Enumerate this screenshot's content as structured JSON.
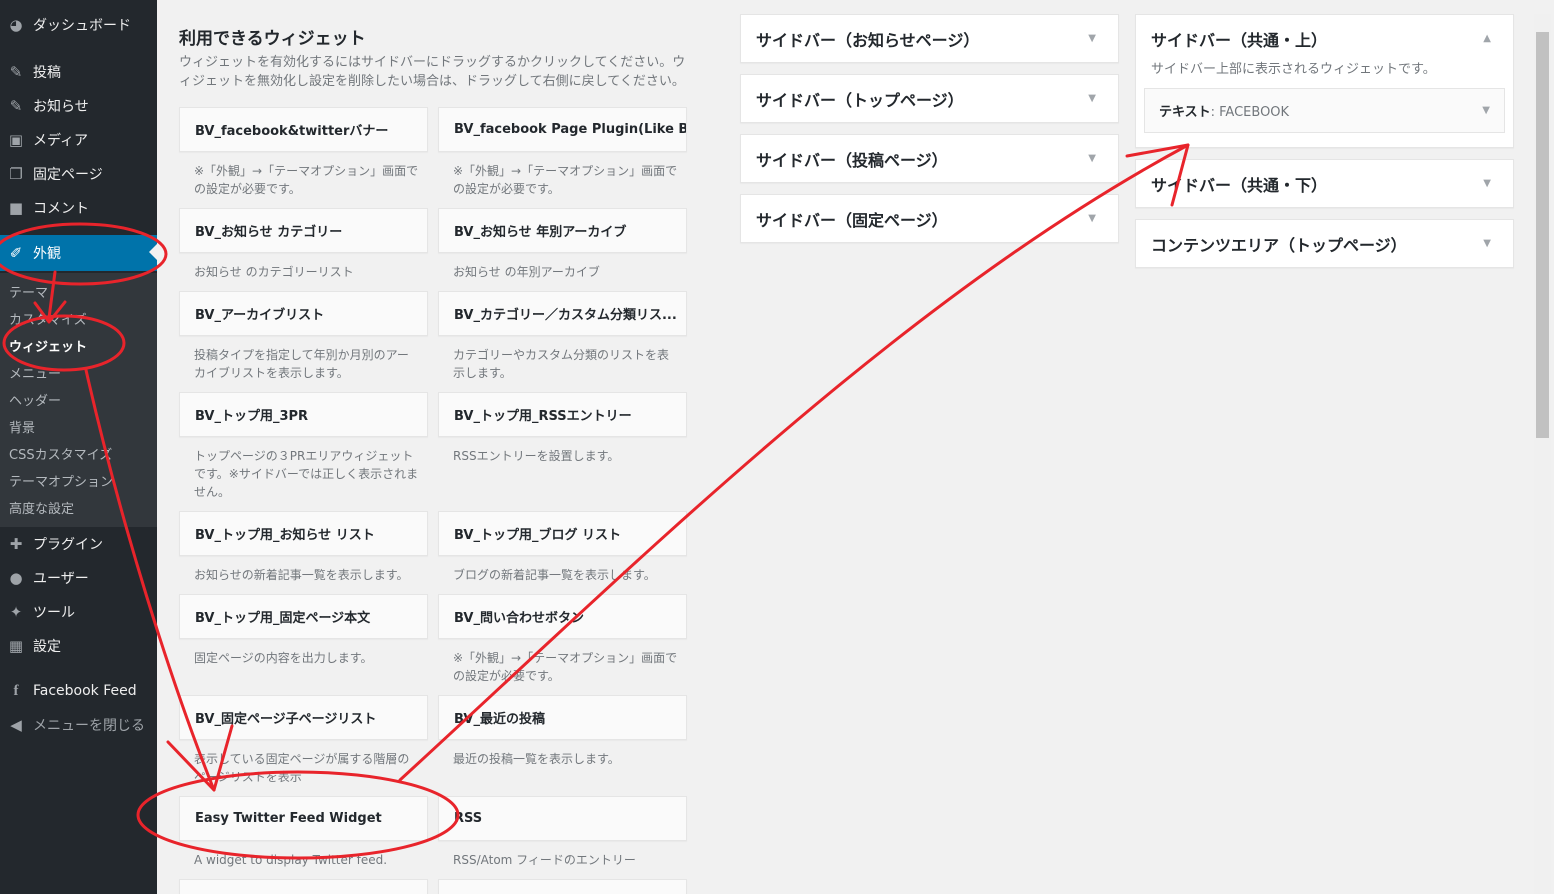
{
  "sidebar": {
    "items": [
      {
        "label": "ダッシュボード",
        "icon": "dashboard-icon"
      },
      {
        "label": "投稿",
        "icon": "pin-icon"
      },
      {
        "label": "お知らせ",
        "icon": "pin-icon"
      },
      {
        "label": "メディア",
        "icon": "media-icon"
      },
      {
        "label": "固定ページ",
        "icon": "page-icon"
      },
      {
        "label": "コメント",
        "icon": "comment-icon"
      },
      {
        "label": "外観",
        "icon": "brush-icon"
      },
      {
        "label": "プラグイン",
        "icon": "plugin-icon"
      },
      {
        "label": "ユーザー",
        "icon": "user-icon"
      },
      {
        "label": "ツール",
        "icon": "wrench-icon"
      },
      {
        "label": "設定",
        "icon": "settings-icon"
      },
      {
        "label": "Facebook Feed",
        "icon": "facebook-icon"
      },
      {
        "label": "メニューを閉じる",
        "icon": "collapse-icon"
      }
    ],
    "submenu": [
      "テーマ",
      "カスタマイズ",
      "ウィジェット",
      "メニュー",
      "ヘッダー",
      "背景",
      "CSSカスタマイズ",
      "テーマオプション",
      "高度な設定"
    ]
  },
  "available": {
    "title": "利用できるウィジェット",
    "description": "ウィジェットを有効化するにはサイドバーにドラッグするかクリックしてください。ウィジェットを無効化し設定を削除したい場合は、ドラッグして右側に戻してください。",
    "widgets": [
      {
        "name": "BV_facebook&twitterバナー",
        "desc": "※「外観」→「テーマオプション」画面での設定が必要です。"
      },
      {
        "name": "BV_facebook Page Plugin(Like B...",
        "desc": "※「外観」→「テーマオプション」画面での設定が必要です。"
      },
      {
        "name": "BV_お知らせ カテゴリー",
        "desc": "お知らせ のカテゴリーリスト"
      },
      {
        "name": "BV_お知らせ 年別アーカイブ",
        "desc": "お知らせ の年別アーカイブ"
      },
      {
        "name": "BV_アーカイブリスト",
        "desc": "投稿タイプを指定して年別か月別のアーカイブリストを表示します。"
      },
      {
        "name": "BV_カテゴリー／カスタム分類リス...",
        "desc": "カテゴリーやカスタム分類のリストを表示します。"
      },
      {
        "name": "BV_トップ用_3PR",
        "desc": "トップページの３PRエリアウィジェットです。※サイドバーでは正しく表示されません。"
      },
      {
        "name": "BV_トップ用_RSSエントリー",
        "desc": "RSSエントリーを設置します。"
      },
      {
        "name": "BV_トップ用_お知らせ リスト",
        "desc": "お知らせの新着記事一覧を表示します。"
      },
      {
        "name": "BV_トップ用_ブログ リスト",
        "desc": "ブログの新着記事一覧を表示します。"
      },
      {
        "name": "BV_トップ用_固定ページ本文",
        "desc": "固定ページの内容を出力します。"
      },
      {
        "name": "BV_問い合わせボタン",
        "desc": "※「外観」→「テーマオプション」画面での設定が必要です。"
      },
      {
        "name": "BV_固定ページ子ページリスト",
        "desc": "表示している固定ページが属する階層のページリストを表示"
      },
      {
        "name": "BV_最近の投稿",
        "desc": "最近の投稿一覧を表示します。"
      },
      {
        "name": "Easy Twitter Feed Widget",
        "desc": "A widget to display Twitter feed."
      },
      {
        "name": "RSS",
        "desc": "RSS/Atom フィードのエントリー"
      }
    ]
  },
  "areas": {
    "col1": [
      "サイドバー（お知らせページ）",
      "サイドバー（トップページ）",
      "サイドバー（投稿ページ）",
      "サイドバー（固定ページ）"
    ],
    "col2": [
      {
        "title": "サイドバー（共通・上）",
        "desc": "サイドバー上部に表示されるウィジェットです。",
        "widget_name": "テキスト",
        "widget_title": ": FACEBOOK"
      },
      {
        "title": "サイドバー（共通・下）"
      },
      {
        "title": "コンテンツエリア（トップページ）"
      }
    ]
  },
  "colors": {
    "sidebar_bg": "#23282d",
    "submenu_bg": "#32373c",
    "accent": "#0073aa",
    "annotation": "#e8242b"
  }
}
